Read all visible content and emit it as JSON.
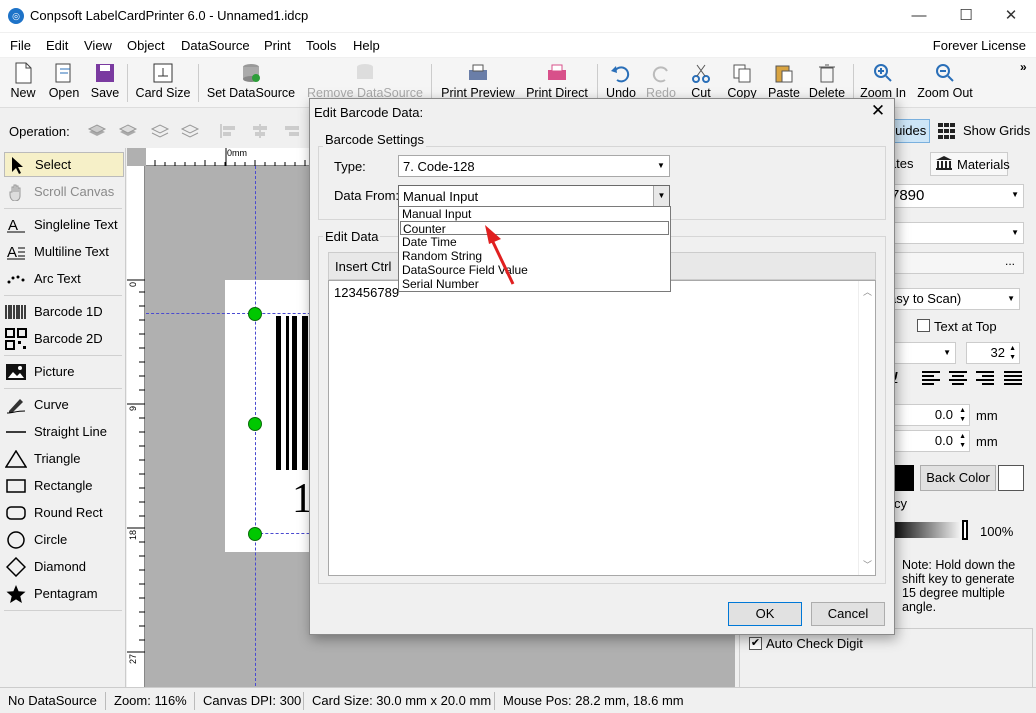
{
  "window": {
    "title": "Conpsoft LabelCardPrinter 6.0 - Unnamed1.idcp",
    "icon": "app-logo-icon"
  },
  "menu": {
    "items": [
      "File",
      "Edit",
      "View",
      "Object",
      "DataSource",
      "Print",
      "Tools",
      "Help"
    ],
    "license": "Forever License"
  },
  "toolbar": {
    "new": "New",
    "open": "Open",
    "save": "Save",
    "card_size": "Card Size",
    "set_datasource": "Set DataSource",
    "remove_datasource": "Remove DataSource",
    "print_preview": "Print Preview",
    "print_direct": "Print Direct",
    "undo": "Undo",
    "redo": "Redo",
    "cut": "Cut",
    "copy": "Copy",
    "paste": "Paste",
    "delete": "Delete",
    "zoom_in": "Zoom In",
    "zoom_out": "Zoom Out"
  },
  "operation": {
    "label": "Operation:",
    "guides": "Guides",
    "show_grids": "Show Grids"
  },
  "tools": {
    "select": "Select",
    "scroll": "Scroll Canvas",
    "singleline": "Singleline Text",
    "multiline": "Multiline Text",
    "arc": "Arc Text",
    "barcode1d": "Barcode 1D",
    "barcode2d": "Barcode 2D",
    "picture": "Picture",
    "curve": "Curve",
    "straight": "Straight Line",
    "triangle": "Triangle",
    "rectangle": "Rectangle",
    "roundrect": "Round Rect",
    "circle": "Circle",
    "diamond": "Diamond",
    "pentagram": "Pentagram"
  },
  "canvas": {
    "ruler_top_0": "0mm",
    "ruler_left": [
      "0",
      "9",
      "18",
      "27"
    ],
    "barcode_digit": "1"
  },
  "right": {
    "tab_templates": "lates",
    "tab_materials": "Materials",
    "data_value": "7890",
    "font_combo": "asy to Scan)",
    "text_at_top": "Text at Top",
    "font_size": "32",
    "offset_x": "0.0",
    "offset_y": "0.0",
    "unit": "mm",
    "back_color": "Back Color",
    "opacity_tail": "cy",
    "opacity_value": "100%",
    "note": "Note: Hold down the shift key to generate 15 degree multiple angle.",
    "auto_check": "Auto Check Digit"
  },
  "status": {
    "datasource": "No DataSource",
    "zoom": "Zoom: 116%",
    "dpi": "Canvas DPI: 300",
    "card_size": "Card Size: 30.0 mm x 20.0 mm",
    "mouse": "Mouse Pos: 28.2 mm, 18.6 mm"
  },
  "dialog": {
    "title": "Edit Barcode Data:",
    "settings_group": "Barcode Settings",
    "type_label": "Type:",
    "type_value": "7.  Code-128",
    "from_label": "Data From:",
    "from_value": "Manual Input",
    "options": [
      "Manual Input",
      "Counter",
      "Date Time",
      "Random String",
      "DataSource Field Value",
      "Serial Number"
    ],
    "edit_group": "Edit Data",
    "insert_label": "Insert Ctrl",
    "data_text": "123456789",
    "ok": "OK",
    "cancel": "Cancel"
  },
  "colors": {
    "accent": "#0078d7",
    "handle": "#00c800",
    "arrow": "#e02020"
  }
}
